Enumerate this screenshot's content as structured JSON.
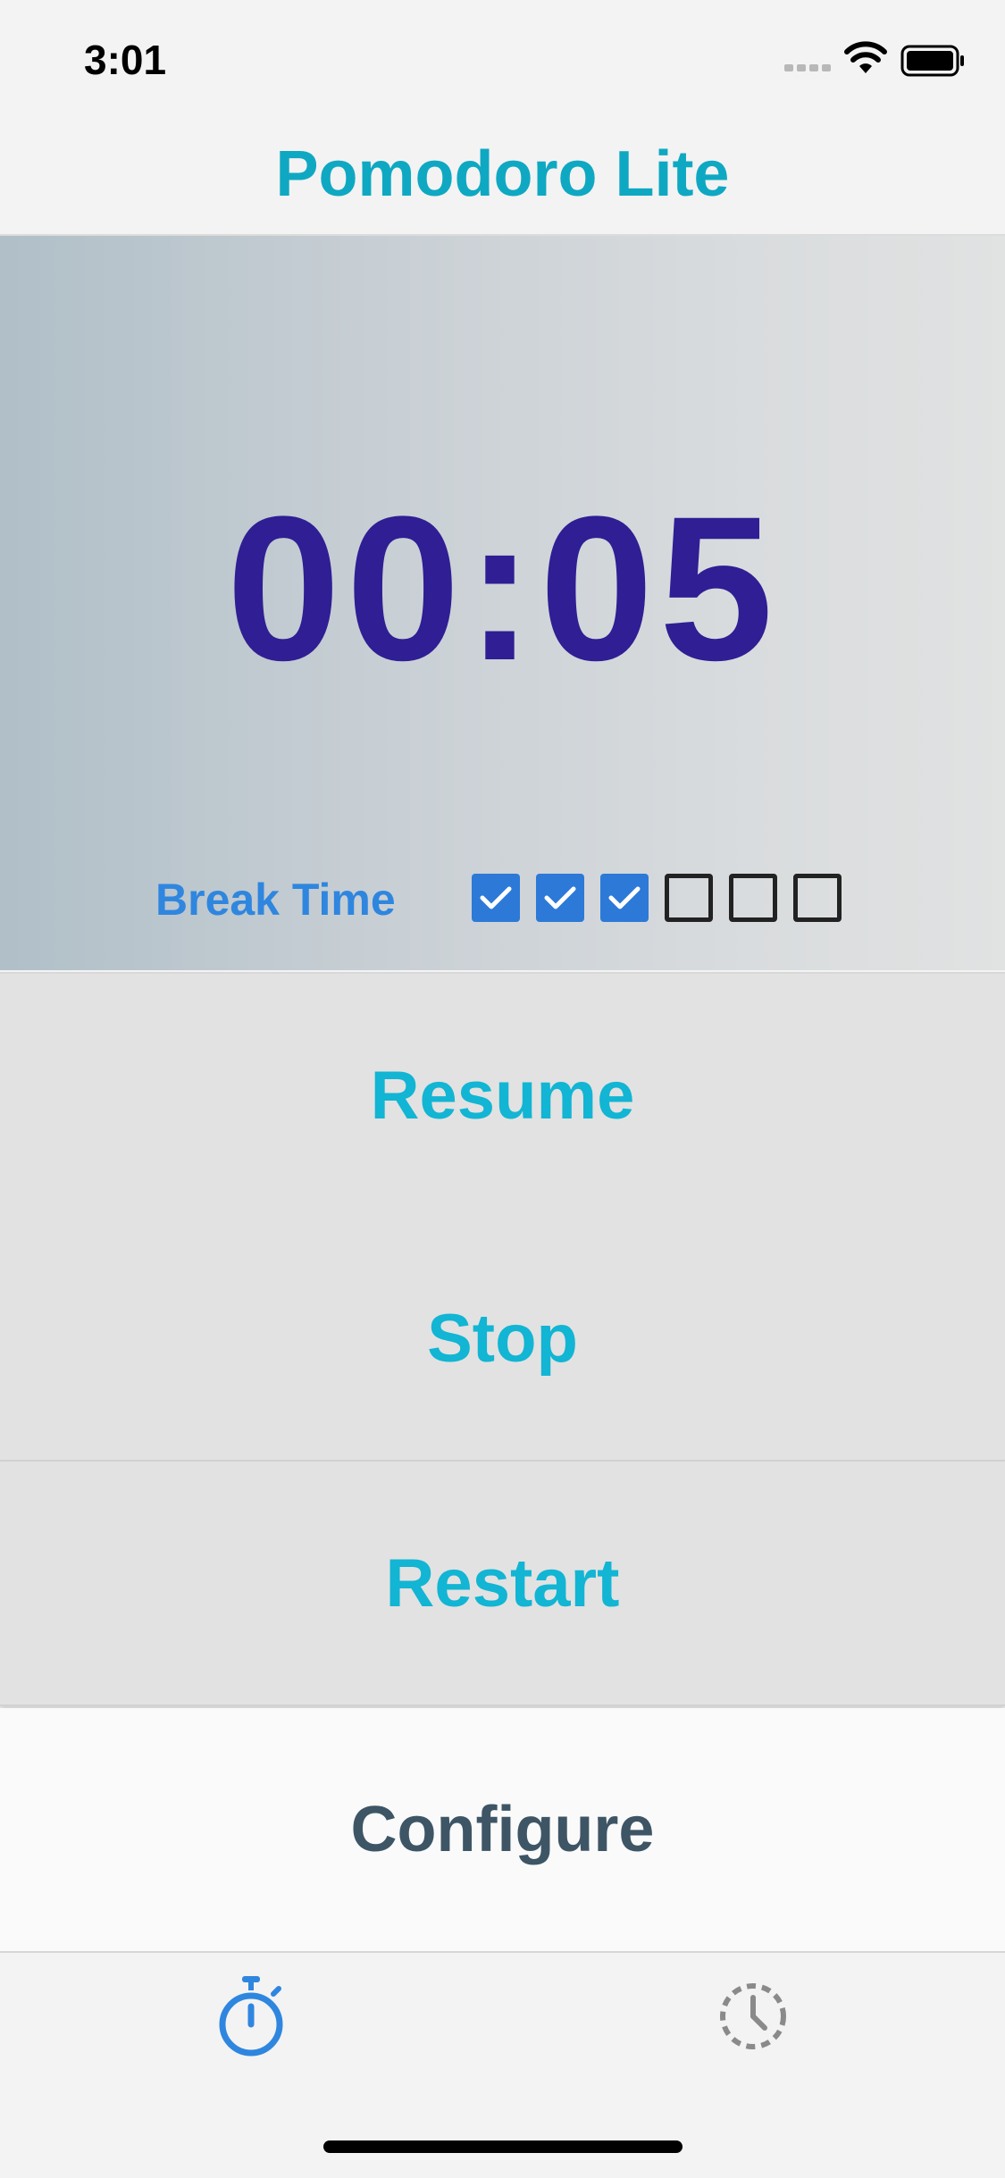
{
  "status_bar": {
    "time": "3:01"
  },
  "navbar": {
    "title": "Pomodoro Lite"
  },
  "timer": {
    "display": "00:05",
    "mode_label": "Break Time",
    "sessions": [
      true,
      true,
      true,
      false,
      false,
      false
    ]
  },
  "actions": {
    "resume": "Resume",
    "stop": "Stop",
    "restart": "Restart",
    "configure": "Configure"
  },
  "tab_bar": {
    "tabs": [
      {
        "icon": "stopwatch-icon",
        "selected": true
      },
      {
        "icon": "history-clock-icon",
        "selected": false
      }
    ]
  },
  "colors": {
    "accent": "#0fa8c2",
    "timer_text": "#2f1e94",
    "break_label": "#2f86df",
    "checkbox_on": "#2c79d8",
    "tab_selected": "#2f86df",
    "tab_unselected": "#8a8a8a"
  }
}
